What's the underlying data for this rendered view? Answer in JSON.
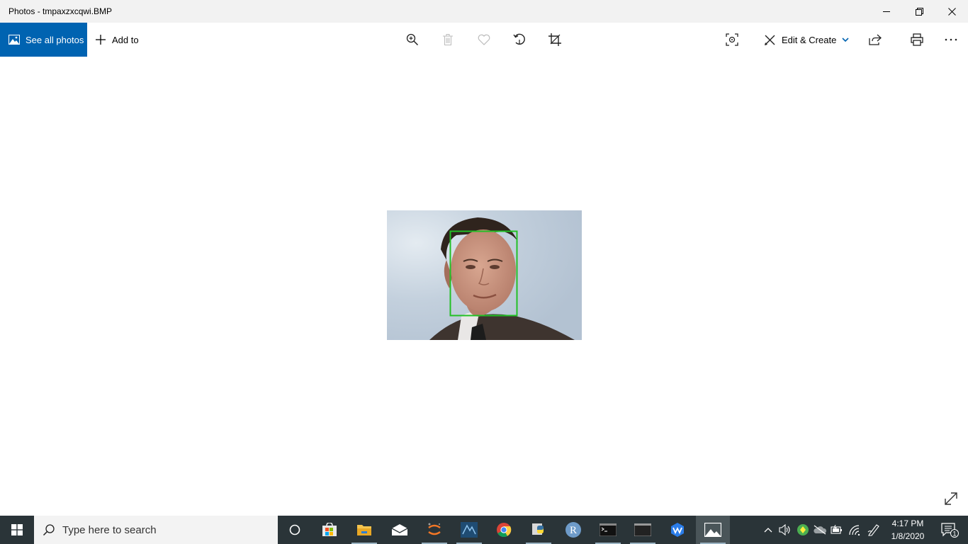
{
  "window": {
    "title": "Photos - tmpaxzxcqwi.BMP"
  },
  "toolbar": {
    "see_all_label": "See all photos",
    "add_to_label": "Add to",
    "edit_create_label": "Edit & Create"
  },
  "colors": {
    "accent": "#0063b1",
    "detection_box": "#22c025",
    "taskbar": "#2a3438"
  },
  "taskbar": {
    "search_placeholder": "Type here to search",
    "apps": [
      "task-view",
      "microsoft-store",
      "file-explorer",
      "mail",
      "jupyter",
      "vs-code",
      "chrome",
      "python",
      "r",
      "terminal",
      "window",
      "wps",
      "photos"
    ],
    "time": "4:17 PM",
    "date": "1/8/2020",
    "notification_count": "1"
  }
}
